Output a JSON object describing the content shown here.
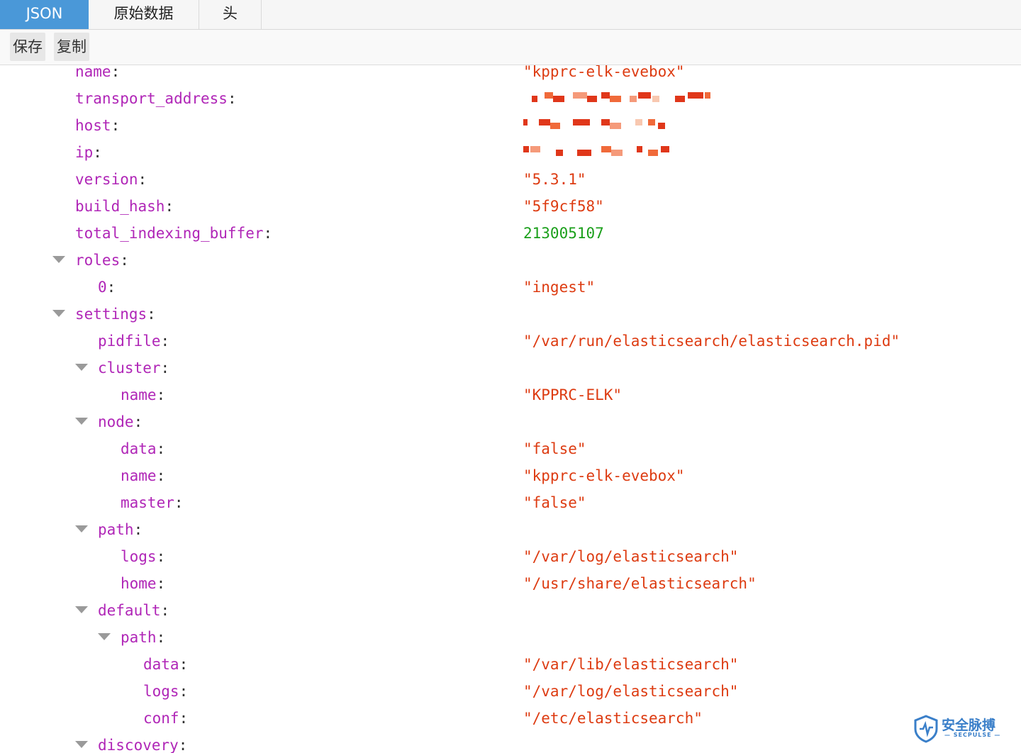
{
  "tabs": [
    {
      "label": "JSON",
      "active": true
    },
    {
      "label": "原始数据",
      "active": false
    },
    {
      "label": "头",
      "active": false
    }
  ],
  "toolbar": {
    "save_label": "保存",
    "copy_label": "复制"
  },
  "json_view": {
    "rows": [
      {
        "key": "name",
        "value": "\"kpprc-elk-evebox\"",
        "kind": "string"
      },
      {
        "key": "transport_address",
        "value": "",
        "kind": "redacted"
      },
      {
        "key": "host",
        "value": "",
        "kind": "redacted"
      },
      {
        "key": "ip",
        "value": "",
        "kind": "redacted"
      },
      {
        "key": "version",
        "value": "\"5.3.1\"",
        "kind": "string"
      },
      {
        "key": "build_hash",
        "value": "\"5f9cf58\"",
        "kind": "string"
      },
      {
        "key": "total_indexing_buffer",
        "value": "213005107",
        "kind": "number"
      },
      {
        "key": "roles",
        "value": "",
        "kind": "object"
      },
      {
        "key": "0",
        "value": "\"ingest\"",
        "kind": "string"
      },
      {
        "key": "settings",
        "value": "",
        "kind": "object"
      },
      {
        "key": "pidfile",
        "value": "\"/var/run/elasticsearch/elasticsearch.pid\"",
        "kind": "string"
      },
      {
        "key": "cluster",
        "value": "",
        "kind": "object"
      },
      {
        "key": "name",
        "value": "\"KPPRC-ELK\"",
        "kind": "string"
      },
      {
        "key": "node",
        "value": "",
        "kind": "object"
      },
      {
        "key": "data",
        "value": "\"false\"",
        "kind": "string"
      },
      {
        "key": "name",
        "value": "\"kpprc-elk-evebox\"",
        "kind": "string"
      },
      {
        "key": "master",
        "value": "\"false\"",
        "kind": "string"
      },
      {
        "key": "path",
        "value": "",
        "kind": "object"
      },
      {
        "key": "logs",
        "value": "\"/var/log/elasticsearch\"",
        "kind": "string"
      },
      {
        "key": "home",
        "value": "\"/usr/share/elasticsearch\"",
        "kind": "string"
      },
      {
        "key": "default",
        "value": "",
        "kind": "object"
      },
      {
        "key": "path",
        "value": "",
        "kind": "object"
      },
      {
        "key": "data",
        "value": "\"/var/lib/elasticsearch\"",
        "kind": "string"
      },
      {
        "key": "logs",
        "value": "\"/var/log/elasticsearch\"",
        "kind": "string"
      },
      {
        "key": "conf",
        "value": "\"/etc/elasticsearch\"",
        "kind": "string"
      },
      {
        "key": "discovery",
        "value": "",
        "kind": "object"
      }
    ]
  },
  "watermark": {
    "title": "安全脉搏",
    "subtitle": "— SECPULSE —"
  },
  "colors": {
    "accent": "#4a98d8",
    "key": "#b026b7",
    "string": "#dd3b11",
    "number": "#1a9f1a",
    "watermark": "#3a7fc9"
  }
}
